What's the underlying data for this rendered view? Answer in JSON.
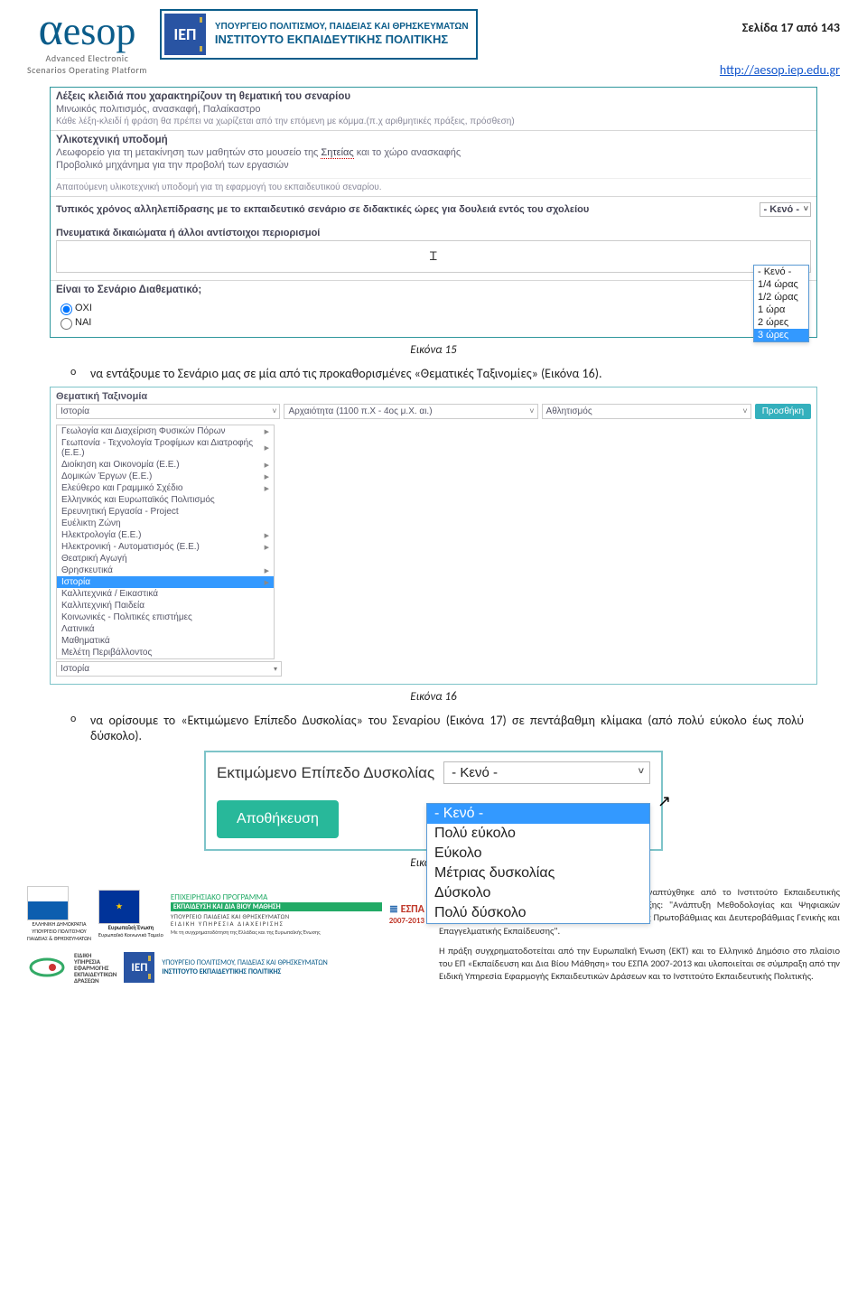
{
  "header": {
    "brand": {
      "word": "æsop",
      "sub1": "Advanced Electronic",
      "sub2": "Scenarios Operating Platform"
    },
    "iep": {
      "abbr": "ΙΕΠ",
      "l1": "ΥΠΟΥΡΓΕΙΟ ΠΟΛΙΤΙΣΜΟΥ, ΠΑΙΔΕΙΑΣ ΚΑΙ ΘΡΗΣΚΕΥΜΑΤΩΝ",
      "l2": "ΙΝΣΤΙΤΟΥΤΟ ΕΚΠΑΙΔΕΥΤΙΚΗΣ ΠΟΛΙΤΙΚΗΣ"
    },
    "page": "Σελίδα 17 από 143",
    "url": "http://aesop.iep.edu.gr"
  },
  "fig1": {
    "kw_label": "Λέξεις κλειδιά που χαρακτηρίζουν τη θεματική του σεναρίου",
    "kw_value": "Μινωικός πολιτισμός, ανασκαφή, Παλαίκαστρο",
    "kw_hint": "Κάθε λέξη-κλειδί ή φράση θα πρέπει να χωρίζεται από την επόμενη με κόμμα.(π.χ αριθμητικές πράξεις, πρόσθεση)",
    "infra_label": "Υλικοτεχνική υποδομή",
    "infra_l1_a": "Λεωφορείο για τη μετακίνηση των μαθητών στο μουσείο της ",
    "infra_l1_link": "Σητείας",
    "infra_l1_b": " και το χώρο ανασκαφής",
    "infra_l2": "Προβολικό μηχάνημα για την προβολή των εργασιών",
    "infra_hint": "Απαιτούμενη υλικοτεχνική υποδομή για τη εφαρμογή του εκπαιδευτικού σεναρίου.",
    "hours_label": "Τυπικός χρόνος αλληλεπίδρασης με το εκπαιδευτικό σενάριο σε διδακτικές ώρες για δουλειά εντός του σχολείου",
    "hours_value": "- Κενό -",
    "hours_options": [
      "- Κενό -",
      "1/4 ώρας",
      "1/2 ώρας",
      "1 ώρα",
      "2 ώρες",
      "3 ώρες"
    ],
    "rights_label": "Πνευματικά δικαιώματα ή άλλοι αντίστοιχοι περιορισμοί",
    "thematic_label": "Είναι το Σενάριο Διαθεματικό;",
    "opt_no": "ΟΧΙ",
    "opt_yes": "ΝΑΙ",
    "caption": "Εικόνα 15"
  },
  "par1": "να εντάξουμε το Σενάριο μας σε μία από τις προκαθορισμένες «Θεματικές Ταξινομίες» (Εικόνα 16).",
  "fig2": {
    "title": "Θεματική Ταξινομία",
    "sel1": "Ιστορία",
    "sel2": "Αρχαιότητα (1100 π.Χ - 4ος μ.Χ. αι.)",
    "sel3": "Αθλητισμός",
    "add": "Προσθήκη",
    "list": [
      "Γεωλογία και Διαχείριση Φυσικών Πόρων",
      "Γεωπονία - Τεχνολογία Τροφίμων και Διατροφής (Ε.Ε.)",
      "Διοίκηση και Οικονομία (Ε.Ε.)",
      "Δομικών Έργων (Ε.Ε.)",
      "Ελεύθερο και Γραμμικό Σχέδιο",
      "Ελληνικός και Ευρωπαϊκός Πολιτισμός",
      "Ερευνητική Εργασία - Project",
      "Ευέλικτη Ζώνη",
      "Ηλεκτρολογία (Ε.Ε.)",
      "Ηλεκτρονική - Αυτοματισμός (Ε.Ε.)",
      "Θεατρική Αγωγή",
      "Θρησκευτικά",
      "Ιστορία",
      "Καλλιτεχνικά / Εικαστικά",
      "Καλλιτεχνική Παιδεία",
      "Κοινωνικές - Πολιτικές επιστήμες",
      "Λατινικά",
      "Μαθηματικά",
      "Μελέτη Περιβάλλοντος"
    ],
    "list_arrows": [
      true,
      true,
      true,
      true,
      true,
      false,
      false,
      false,
      true,
      true,
      false,
      true,
      true,
      false,
      false,
      false,
      false,
      false,
      false
    ],
    "foot": "Ιστορία",
    "caption": "Εικόνα 16"
  },
  "par2": "να ορίσουμε το «Εκτιμώμενο Επίπεδο Δυσκολίας» του Σεναρίου (Εικόνα 17) σε πεντάβαθμη κλίμακα (από πολύ εύκολο έως πολύ δύσκολο).",
  "fig3": {
    "label": "Εκτιμώμενο Επίπεδο Δυσκολίας",
    "value": "- Κενό -",
    "save": "Αποθήκευση",
    "options": [
      "- Κενό -",
      "Πολύ εύκολο",
      "Εύκολο",
      "Μέτριας δυσκολίας",
      "Δύσκολο",
      "Πολύ δύσκολο"
    ],
    "caption": "Εικόνα 17"
  },
  "footer": {
    "prog1": "ΕΠΙΧΕΙΡΗΣΙΑΚΟ ΠΡΟΓΡΑΜΜΑ",
    "prog2": "ΕΚΠΑΙΔΕΥΣΗ ΚΑΙ ΔΙΑ ΒΙΟΥ ΜΑΘΗΣΗ",
    "prog_sub1": "ΥΠΟΥΡΓΕΙΟ ΠΑΙΔΕΙΑΣ ΚΑΙ ΘΡΗΣΚΕΥΜΑΤΩΝ",
    "prog_sub2": "ΕΙΔΙΚΗ ΥΠΗΡΕΣΙΑ ΔΙΑΧΕΙΡΙΣΗΣ",
    "prog_note": "Με τη συγχρηματοδότηση της Ελλάδας και της Ευρωπαϊκής Ένωσης",
    "espa": "ΕΣΠΑ",
    "espa_year": "2007-2013",
    "eu_cap1": "Ευρωπαϊκή Ένωση",
    "eu_cap2": "Ευρωπαϊκό Κοινωνικό Ταμείο",
    "gr_cap1": "ΕΛΛΗΝΙΚΗ ΔΗΜΟΚΡΑΤΙΑ",
    "gr_cap2": "ΥΠΟΥΡΓΕΙΟ ΠΟΛΙΤΙΣΜΟΥ",
    "gr_cap3": "ΠΑΙΔΕΙΑΣ & ΘΡΗΣΚΕΥΜΑΤΩΝ",
    "eye1": "ΕΙΔΙΚΗ",
    "eye2": "ΥΠΗΡΕΣΙΑ",
    "eye3": "ΕΦΑΡΜΟΓΗΣ",
    "eye4": "ΕΚΠΑΙΔΕΥΤΙΚΩΝ",
    "eye5": "ΔΡΑΣΕΩΝ",
    "iep_foot1": "ΥΠΟΥΡΓΕΙΟ ΠΟΛΙΤΙΣΜΟΥ, ΠΑΙΔΕΙΑΣ ΚΑΙ ΘΡΗΣΚΕΥΜΑΤΩΝ",
    "iep_foot2": "ΙΝΣΤΙΤΟΥΤΟ ΕΚΠΑΙΔΕΥΤΙΚΗΣ ΠΟΛΙΤΙΚΗΣ",
    "t1": "Η πλατφόρμα Ψηφιακών Διδακτικών Σεναρίων αναπτύχθηκε από το Ινστιτούτο Εκπαιδευτικής Πολιτικής στο πλαίσιο του Υποέργου 2 της Πράξης: \"Ανάπτυξη Μεθοδολογίας και Ψηφιακών Διδακτικών Σεναρίων για τα Γνωστικά Αντικείμενα της Πρωτοβάθμιας και Δευτεροβάθμιας Γενικής και Επαγγελματικής Εκπαίδευσης\".",
    "t2": "Η πράξη συγχρηματοδοτείται από την Ευρωπαϊκή Ένωση (ΕΚΤ) και το Ελληνικό Δημόσιο στο πλαίσιο του ΕΠ «Εκπαίδευση και Δια Βίου Μάθηση» του ΕΣΠΑ 2007-2013 και υλοποιείται σε σύμπραξη από την Ειδική Υπηρεσία Εφαρμογής Εκπαιδευτικών Δράσεων και το Ινστιτούτο Εκπαιδευτικής Πολιτικής."
  }
}
